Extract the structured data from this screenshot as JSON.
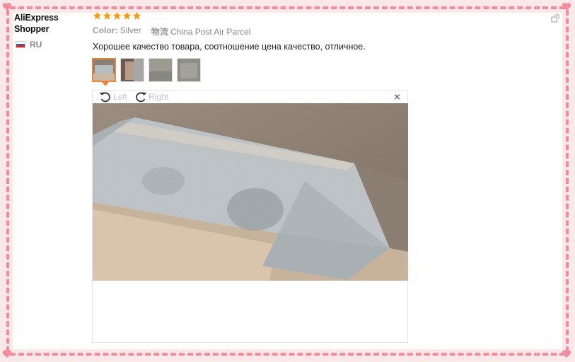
{
  "reviewer": {
    "name_line1": "AliExpress",
    "name_line2": "Shopper",
    "country": "RU"
  },
  "rating": {
    "stars": 5,
    "max": 5
  },
  "meta": {
    "color_label": "Color:",
    "color_value": "Silver",
    "shipping_label": "物流",
    "shipping_value": "China Post Air Parcel"
  },
  "review": {
    "text": "Хорошее качество товара, соотношение цена качество, отличное."
  },
  "viewer": {
    "rotate_left_label": "Left",
    "rotate_right_label": "Right",
    "close_label": "×"
  },
  "colors": {
    "frame_dash": "#f48a9c",
    "frame_bg": "#fbe9ea",
    "star": "#f39c12",
    "thumb_active": "#e8883e"
  },
  "icons": {
    "rotate_left": "rotate-left-icon",
    "rotate_right": "rotate-right-icon",
    "close": "close-icon",
    "star": "star-icon",
    "flag": "russia-flag-icon",
    "heart": "heart-icon"
  }
}
